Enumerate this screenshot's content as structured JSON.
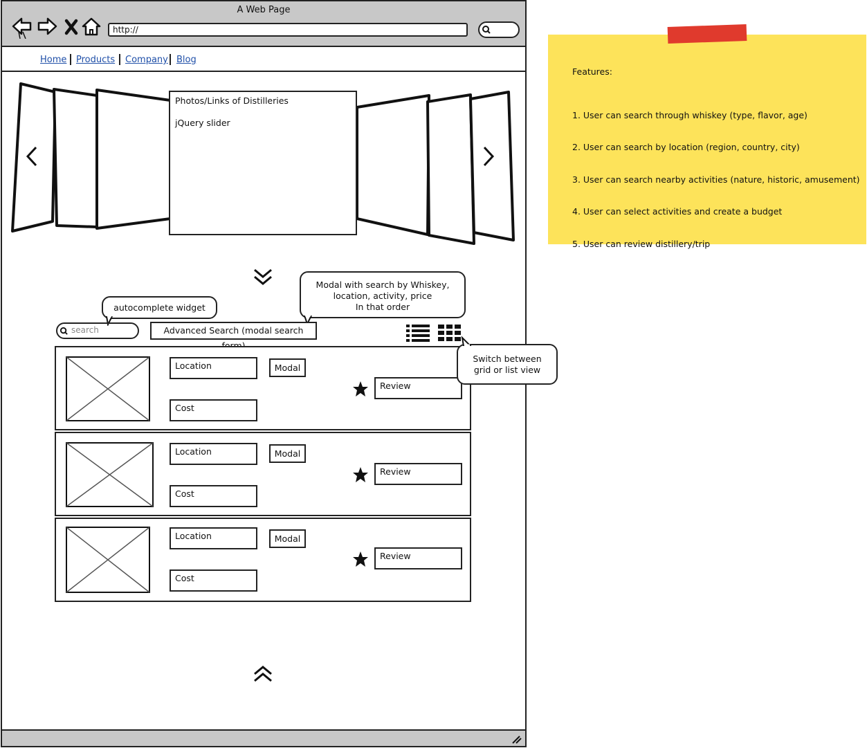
{
  "window": {
    "title": "A Web Page",
    "url": "http://"
  },
  "nav": {
    "links": [
      "Home",
      "Products",
      "Company",
      "Blog"
    ]
  },
  "slider": {
    "line1": "Photos/Links of Distilleries",
    "line2": "jQuery slider"
  },
  "callouts": {
    "autocomplete": "autocomplete widget",
    "modal_line1": "Modal with search by Whiskey,",
    "modal_line2": "location, activity, price",
    "modal_line3": "In that order",
    "switch_line1": "Switch between",
    "switch_line2": "grid or list view"
  },
  "toolbar": {
    "search_placeholder": "search",
    "advanced_search": "Advanced Search (modal search form)"
  },
  "results": [
    {
      "location": "Location",
      "cost": "Cost",
      "modal": "Modal",
      "review": "Review"
    },
    {
      "location": "Location",
      "cost": "Cost",
      "modal": "Modal",
      "review": "Review"
    },
    {
      "location": "Location",
      "cost": "Cost",
      "modal": "Modal",
      "review": "Review"
    }
  ],
  "sticky": {
    "heading": "Features:",
    "items": [
      "1. User can search through whiskey (type, flavor, age)",
      "2. User can search by location (region, country, city)",
      "3. User can search nearby activities (nature, historic, amusement)",
      "4. User can select activities and create a budget",
      "5. User can review distillery/trip"
    ]
  },
  "colors": {
    "sticky": "#fde35a",
    "tape": "#e03a2d",
    "chrome": "#c8c8c8",
    "link": "#1f4fa8"
  }
}
